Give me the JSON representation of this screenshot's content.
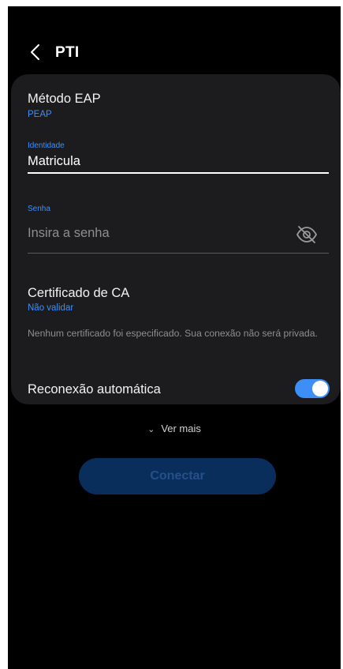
{
  "header": {
    "title": "PTI"
  },
  "eap": {
    "title": "Método EAP",
    "value": "PEAP"
  },
  "identity": {
    "label": "Identidade",
    "value": "Matricula"
  },
  "password": {
    "label": "Senha",
    "placeholder": "Insira a senha"
  },
  "certificate": {
    "title": "Certificado de CA",
    "value": "Não validar",
    "note": "Nenhum certificado foi especificado. Sua conexão não será privada."
  },
  "auto_reconnect": {
    "label": "Reconexão automática",
    "enabled": true
  },
  "more": {
    "label": "Ver mais"
  },
  "connect": {
    "label": "Conectar"
  },
  "colors": {
    "background": "#000000",
    "card": "#1c1c1e",
    "accent": "#3e8ef7",
    "button_disabled_bg": "#0a2e5c",
    "button_disabled_text": "#24518a"
  }
}
